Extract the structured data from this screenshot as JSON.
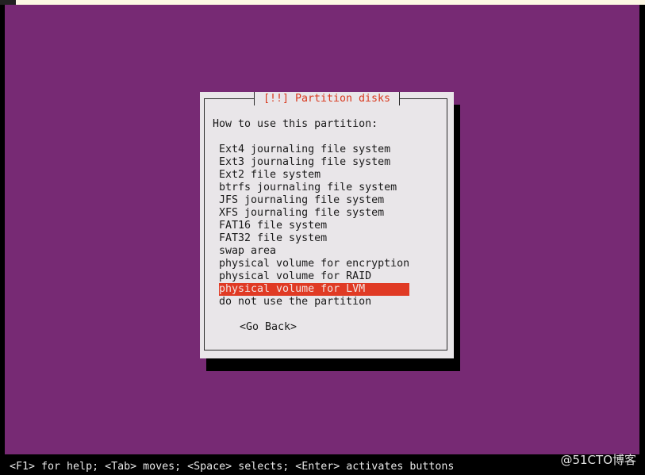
{
  "dialog": {
    "title": "[!!] Partition disks",
    "prompt": "How to use this partition:",
    "options": [
      "Ext4 journaling file system",
      "Ext3 journaling file system",
      "Ext2 file system",
      "btrfs journaling file system",
      "JFS journaling file system",
      "XFS journaling file system",
      "FAT16 file system",
      "FAT32 file system",
      "swap area",
      "physical volume for encryption",
      "physical volume for RAID",
      "physical volume for LVM",
      "do not use the partition"
    ],
    "selected_option": "physical volume for LVM",
    "go_back_label": "<Go Back>"
  },
  "help_bar": "<F1> for help; <Tab> moves; <Space> selects; <Enter> activates buttons",
  "watermark": "@51CTO博客",
  "colors": {
    "background": "#772a74",
    "dialog": "#e9e6e9",
    "title_text": "#d9391f",
    "selection": "#e03a24"
  }
}
